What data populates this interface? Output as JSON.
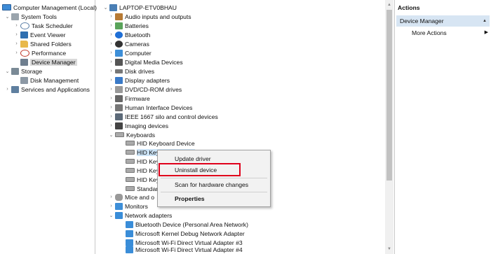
{
  "left_tree": {
    "root": "Computer Management (Local)",
    "system_tools": "System Tools",
    "task_scheduler": "Task Scheduler",
    "event_viewer": "Event Viewer",
    "shared_folders": "Shared Folders",
    "performance": "Performance",
    "device_manager": "Device Manager",
    "storage": "Storage",
    "disk_management": "Disk Management",
    "services": "Services and Applications"
  },
  "device_tree": {
    "computer_name": "LAPTOP-ETV0BHAU",
    "categories": {
      "audio": "Audio inputs and outputs",
      "batteries": "Batteries",
      "bluetooth": "Bluetooth",
      "cameras": "Cameras",
      "computer": "Computer",
      "digital_media": "Digital Media Devices",
      "disk_drives": "Disk drives",
      "display": "Display adapters",
      "dvd": "DVD/CD-ROM drives",
      "firmware": "Firmware",
      "hid": "Human Interface Devices",
      "ieee": "IEEE 1667 silo and control devices",
      "imaging": "Imaging devices",
      "keyboards": "Keyboards",
      "mice": "Mice and o",
      "monitors": "Monitors",
      "network": "Network adapters"
    },
    "keyboards": [
      "HID Keyboard Device",
      "HID Keyboard Device",
      "HID Key",
      "HID Key",
      "HID Key",
      "Standar"
    ],
    "network_adapters": [
      "Bluetooth Device (Personal Area Network)",
      "Microsoft Kernel Debug Network Adapter",
      "Microsoft Wi-Fi Direct Virtual Adapter #3",
      "Microsoft Wi-Fi Direct Virtual Adapter #4"
    ]
  },
  "context_menu": {
    "update_driver": "Update driver",
    "uninstall_device": "Uninstall device",
    "scan": "Scan for hardware changes",
    "properties": "Properties"
  },
  "actions": {
    "header": "Actions",
    "device_manager": "Device Manager",
    "more_actions": "More Actions"
  },
  "colors": {
    "selection": "#cce4f7",
    "actions_selected": "#d7e5f3",
    "highlight_box": "#e0001b"
  }
}
